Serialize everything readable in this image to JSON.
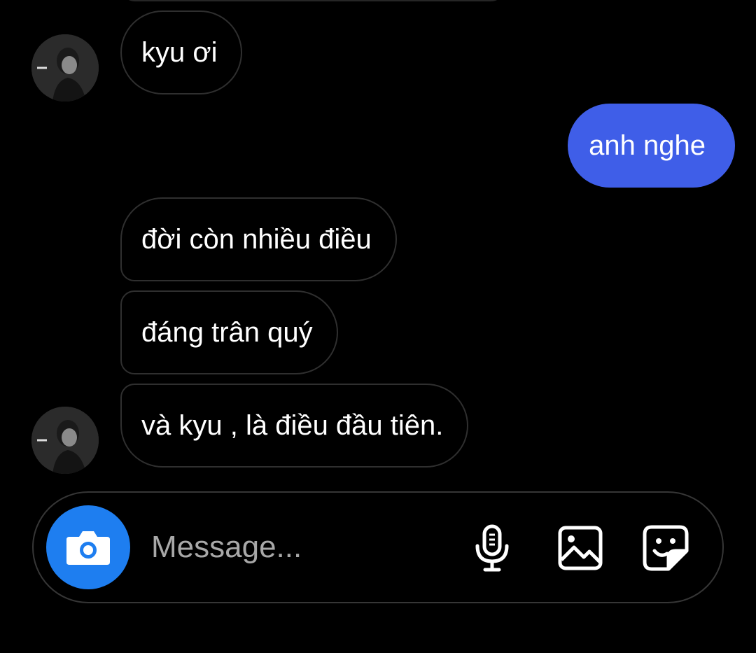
{
  "messages": [
    {
      "id": "m1",
      "side": "incoming",
      "text": "kyu ơi"
    },
    {
      "id": "m2",
      "side": "outgoing",
      "text": "anh nghe"
    },
    {
      "id": "m3",
      "side": "incoming",
      "text": "đời còn nhiều điều"
    },
    {
      "id": "m4",
      "side": "incoming",
      "text": "đáng trân quý"
    },
    {
      "id": "m5",
      "side": "incoming",
      "text": "và kyu , là điều đầu tiên."
    }
  ],
  "composer": {
    "placeholder": "Message...",
    "value": "",
    "icons": [
      "camera-icon",
      "microphone-icon",
      "gallery-icon",
      "sticker-icon"
    ]
  },
  "colors": {
    "background": "#000000",
    "outgoing_bubble": "#3f5ee8",
    "incoming_border": "#2f2f2f",
    "camera_button": "#1e7ef0",
    "placeholder_text": "#a8a8a8"
  }
}
